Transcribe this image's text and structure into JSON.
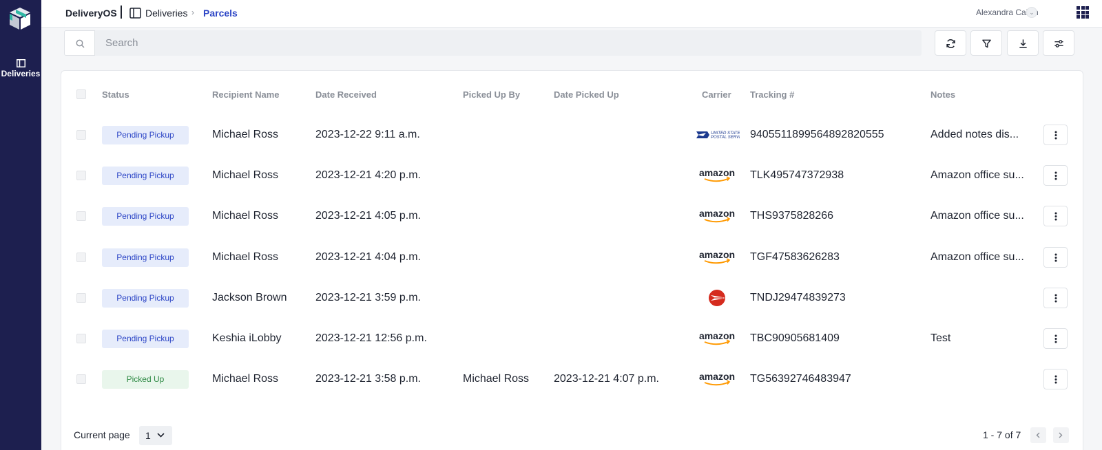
{
  "app": {
    "name": "DeliveryOS"
  },
  "nav": {
    "rail_item_label": "Deliveries"
  },
  "breadcrumb": {
    "section": "Deliveries",
    "page": "Parcels"
  },
  "user": {
    "name": "Alexandra Calvin"
  },
  "search": {
    "placeholder": "Search"
  },
  "toolbar": {
    "refresh": "refresh-icon",
    "filter": "filter-icon",
    "download": "download-icon",
    "settings": "sliders-icon"
  },
  "table": {
    "headers": {
      "status": "Status",
      "recipient": "Recipient Name",
      "date_received": "Date Received",
      "picked_up_by": "Picked Up By",
      "date_picked_up": "Date Picked Up",
      "carrier": "Carrier",
      "tracking": "Tracking #",
      "notes": "Notes"
    },
    "rows": [
      {
        "status": "Pending Pickup",
        "recipient": "Michael Ross",
        "date_received": "2023-12-22 9:11 a.m.",
        "picked_up_by": "",
        "date_picked_up": "",
        "carrier": "usps",
        "tracking": "9405511899564892820555",
        "notes": "Added notes dis..."
      },
      {
        "status": "Pending Pickup",
        "recipient": "Michael Ross",
        "date_received": "2023-12-21 4:20 p.m.",
        "picked_up_by": "",
        "date_picked_up": "",
        "carrier": "amazon",
        "tracking": "TLK495747372938",
        "notes": "Amazon office su..."
      },
      {
        "status": "Pending Pickup",
        "recipient": "Michael Ross",
        "date_received": "2023-12-21 4:05 p.m.",
        "picked_up_by": "",
        "date_picked_up": "",
        "carrier": "amazon",
        "tracking": "THS9375828266",
        "notes": "Amazon office su..."
      },
      {
        "status": "Pending Pickup",
        "recipient": "Michael Ross",
        "date_received": "2023-12-21 4:04 p.m.",
        "picked_up_by": "",
        "date_picked_up": "",
        "carrier": "amazon",
        "tracking": "TGF47583626283",
        "notes": "Amazon office su..."
      },
      {
        "status": "Pending Pickup",
        "recipient": "Jackson Brown",
        "date_received": "2023-12-21 3:59 p.m.",
        "picked_up_by": "",
        "date_picked_up": "",
        "carrier": "canada-post",
        "tracking": "TNDJ29474839273",
        "notes": ""
      },
      {
        "status": "Pending Pickup",
        "recipient": "Keshia iLobby",
        "date_received": "2023-12-21 12:56 p.m.",
        "picked_up_by": "",
        "date_picked_up": "",
        "carrier": "amazon",
        "tracking": "TBC90905681409",
        "notes": "Test"
      },
      {
        "status": "Picked Up",
        "recipient": "Michael Ross",
        "date_received": "2023-12-21 3:58 p.m.",
        "picked_up_by": "Michael Ross",
        "date_picked_up": "2023-12-21 4:07 p.m.",
        "carrier": "amazon",
        "tracking": "TG56392746483947",
        "notes": ""
      }
    ]
  },
  "carrier_logos": {
    "usps_line1": "UNITED STATES",
    "usps_line2": "POSTAL SERVICE",
    "amazon": "amazon"
  },
  "pagination": {
    "label": "Current page",
    "current": "1",
    "range": "1 - 7 of 7"
  },
  "colors": {
    "rail": "#1d1f4f",
    "accent": "#2d46c6",
    "pending_bg": "#e6ecfb",
    "picked_bg": "#e9f6ec",
    "picked_text": "#2f8a45",
    "canada_post": "#d52b1e",
    "amazon_smile": "#f90"
  }
}
